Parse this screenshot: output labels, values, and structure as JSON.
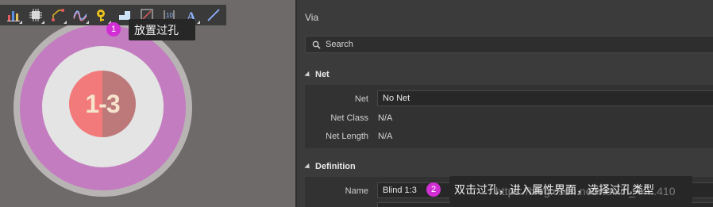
{
  "toolbar": {
    "tools": [
      {
        "icon": "bar-chart-icon"
      },
      {
        "icon": "chip-component-icon"
      },
      {
        "icon": "route-track-icon"
      },
      {
        "icon": "diff-pair-wave-icon"
      },
      {
        "icon": "place-via-icon"
      },
      {
        "icon": "place-fill-icon"
      },
      {
        "icon": "place-region-icon"
      },
      {
        "icon": "place-dimension-icon"
      },
      {
        "icon": "place-text-icon"
      },
      {
        "icon": "place-line-icon"
      }
    ]
  },
  "canvas": {
    "via_label": "1-3",
    "colors": {
      "outer": "#b7b4b3",
      "ring": "#c47cc0",
      "pad": "#e4e4e4",
      "hole_left": "#f27a7a",
      "hole_right": "#bd7979"
    }
  },
  "callouts": [
    {
      "number": "1",
      "text": "放置过孔"
    },
    {
      "number": "2",
      "text": "双击过孔，进入属性界面，选择过孔类型"
    }
  ],
  "panel": {
    "title": "Via",
    "search_placeholder": "Search",
    "sections": {
      "net": {
        "header": "Net",
        "net_label": "Net",
        "net_value": "No Net",
        "netclass_label": "Net Class",
        "netclass_value": "N/A",
        "netlength_label": "Net Length",
        "netlength_value": "N/A"
      },
      "definition": {
        "header": "Definition",
        "name_label": "Name",
        "name_value": "Blind 1:3"
      }
    }
  },
  "watermark": "https://blog.csdn.net/weixin_44...410"
}
